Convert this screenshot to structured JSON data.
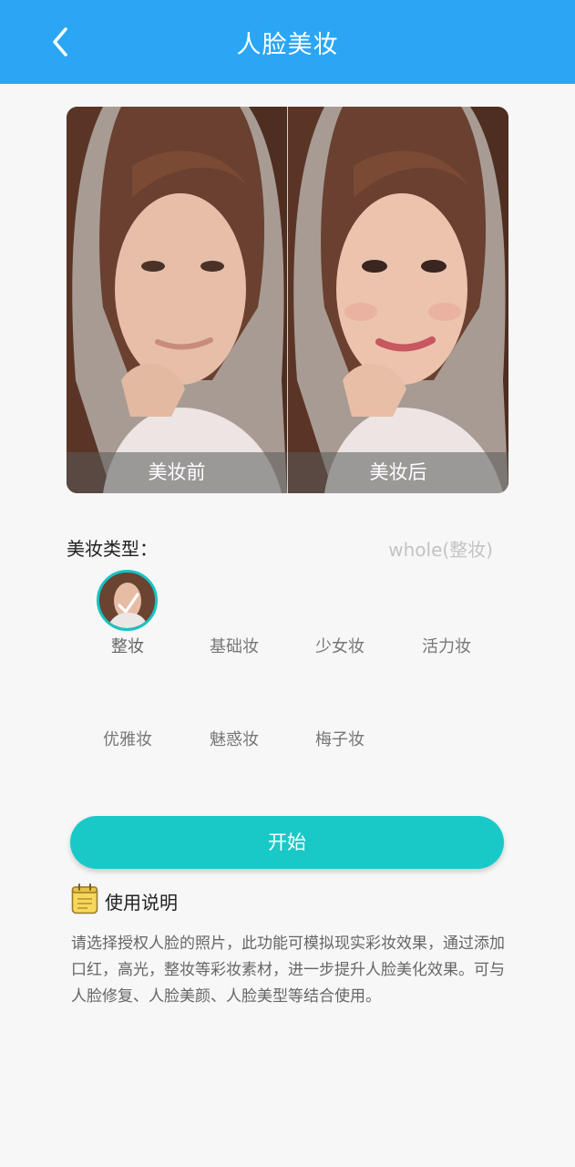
{
  "header": {
    "title": "人脸美妆",
    "back_icon": "chevron-left-icon"
  },
  "compare": {
    "before_label": "美妆前",
    "after_label": "美妆后"
  },
  "makeup_type": {
    "label": "美妆类型：",
    "selected_value": "whole(整妆)",
    "options": [
      "整妆",
      "基础妆",
      "少女妆",
      "活力妆",
      "优雅妆",
      "魅惑妆",
      "梅子妆"
    ],
    "selected_index": 0
  },
  "start_button": "开始",
  "instructions": {
    "icon": "notepad-icon",
    "title": "使用说明",
    "text": "请选择授权人脸的照片，此功能可模拟现实彩妆效果，通过添加口红，高光，整妆等彩妆素材，进一步提升人脸美化效果。可与人脸修复、人脸美颜、人脸美型等结合使用。"
  },
  "colors": {
    "header": "#2aa6f5",
    "accent": "#19c9c8"
  }
}
